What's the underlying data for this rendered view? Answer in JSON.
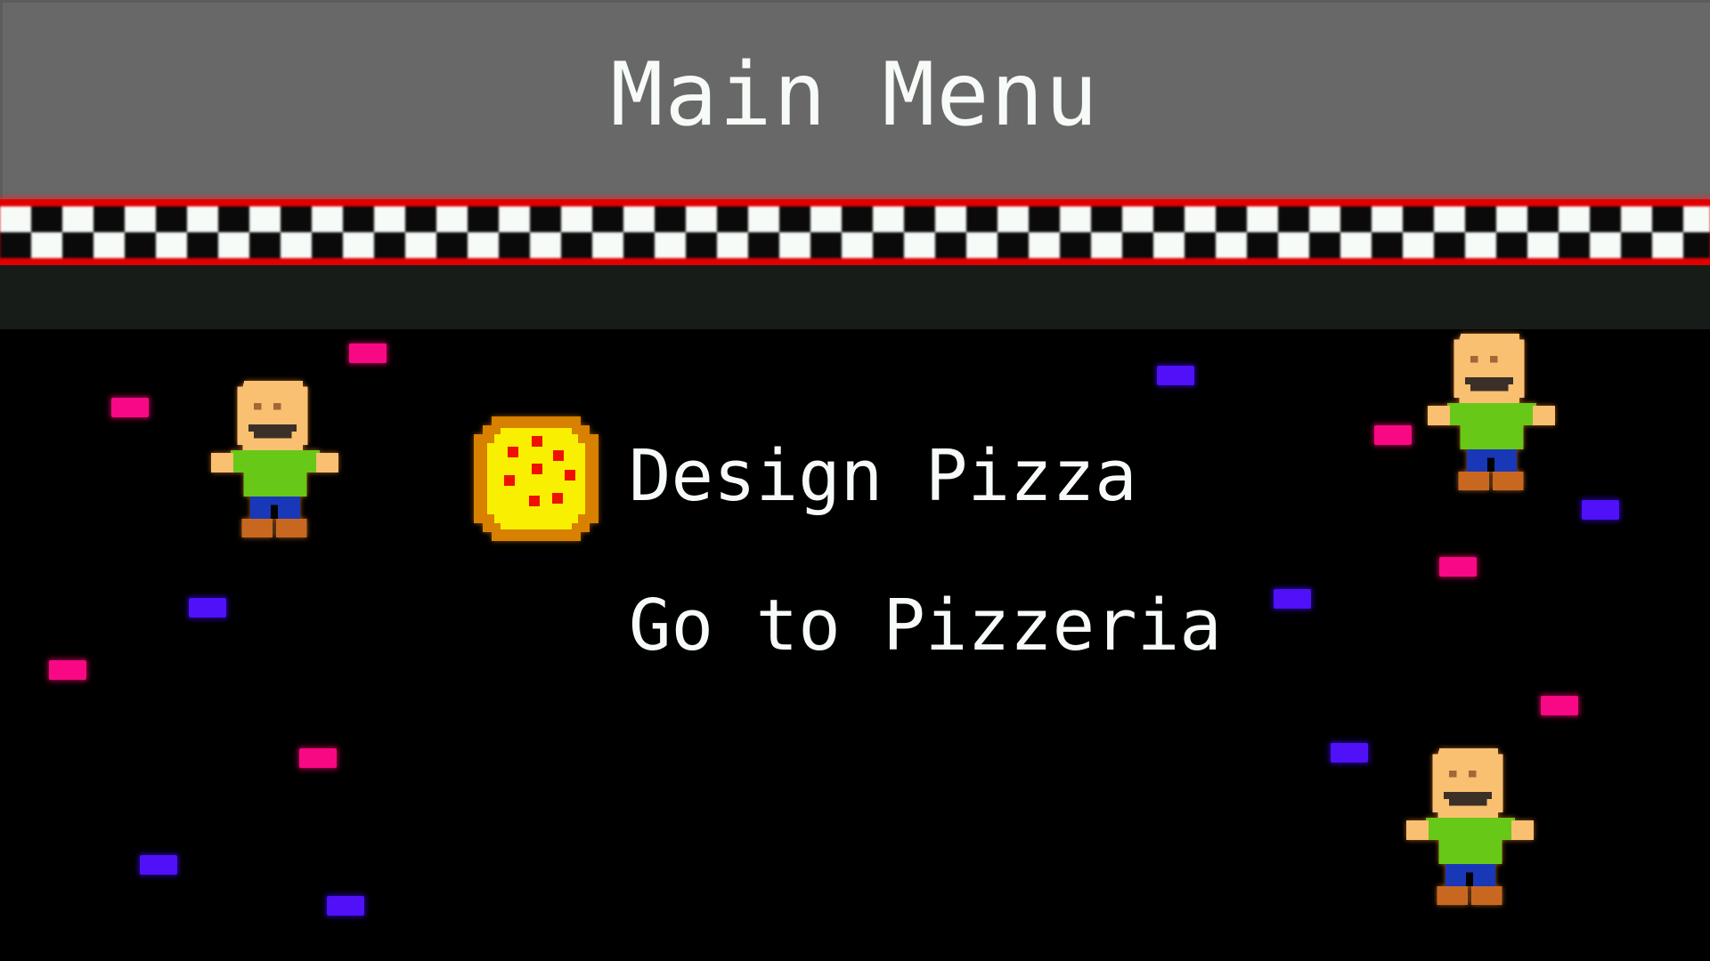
{
  "header": {
    "title": "Main Menu"
  },
  "menu": {
    "items": [
      {
        "label": "Design Pizza",
        "selected": true
      },
      {
        "label": "Go to Pizzeria",
        "selected": false
      }
    ],
    "selection_icon": "pizza-icon"
  },
  "colors": {
    "header_bg": "#686868",
    "title_text": "#f7fbf7",
    "checker_border": "#e00000",
    "checker_light": "#f7fbf7",
    "checker_dark": "#0a0a0a",
    "dark_bar": "#181c18",
    "background": "#000000",
    "menu_text": "#f7fbf7",
    "confetti_pink": "#f80884",
    "confetti_blue": "#5010f8",
    "pizza_crust": "#d88000",
    "pizza_cheese": "#f8f000",
    "pizza_pepperoni": "#f01000",
    "kid_skin": "#f8c070",
    "kid_shirt": "#68c818",
    "kid_pants": "#1838b8",
    "kid_shoes": "#c86820"
  },
  "decorations": {
    "characters": [
      "happy-kid",
      "happy-kid",
      "happy-kid"
    ],
    "confetti": [
      "pink",
      "pink",
      "pink",
      "pink",
      "pink",
      "pink",
      "pink",
      "blue",
      "blue",
      "blue",
      "blue",
      "blue",
      "blue",
      "blue"
    ]
  }
}
